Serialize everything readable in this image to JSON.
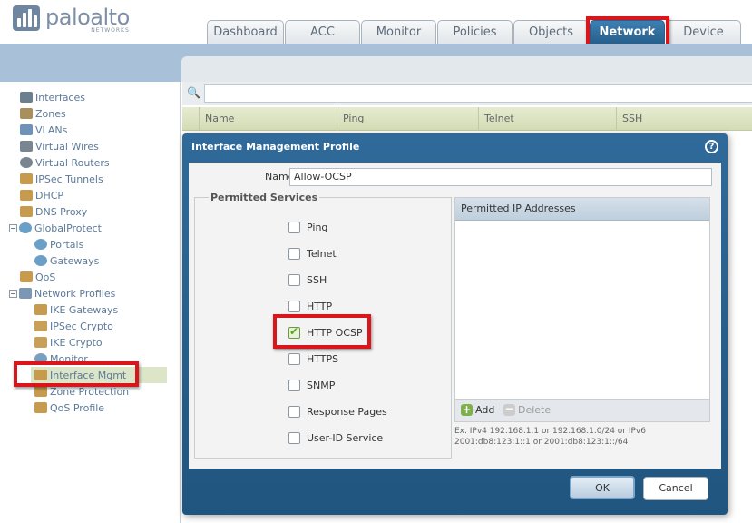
{
  "brand": {
    "name": "paloalto",
    "sub": "NETWORKS"
  },
  "tabs": [
    {
      "label": "Dashboard"
    },
    {
      "label": "ACC"
    },
    {
      "label": "Monitor"
    },
    {
      "label": "Policies"
    },
    {
      "label": "Objects"
    },
    {
      "label": "Network",
      "active": true
    },
    {
      "label": "Device"
    }
  ],
  "sidebar": {
    "items": [
      {
        "label": "Interfaces",
        "icon": "interfaces-icon",
        "color": "#6b7f8f"
      },
      {
        "label": "Zones",
        "icon": "zones-icon",
        "color": "#a98f5b"
      },
      {
        "label": "VLANs",
        "icon": "vlans-icon",
        "color": "#6f93b8"
      },
      {
        "label": "Virtual Wires",
        "icon": "virtual-wires-icon",
        "color": "#7a8592"
      },
      {
        "label": "Virtual Routers",
        "icon": "virtual-routers-icon",
        "color": "#7a8592"
      },
      {
        "label": "IPSec Tunnels",
        "icon": "ipsec-tunnels-icon",
        "color": "#c79b4d"
      },
      {
        "label": "DHCP",
        "icon": "dhcp-icon",
        "color": "#c79b4d"
      },
      {
        "label": "DNS Proxy",
        "icon": "dns-proxy-icon",
        "color": "#c79b4d"
      },
      {
        "label": "GlobalProtect",
        "icon": "globalprotect-icon",
        "color": "#6aa0c8"
      },
      {
        "label": "Portals",
        "icon": "portals-icon",
        "color": "#6aa0c8"
      },
      {
        "label": "Gateways",
        "icon": "gateways-icon",
        "color": "#6aa0c8"
      },
      {
        "label": "QoS",
        "icon": "qos-icon",
        "color": "#c79b4d"
      },
      {
        "label": "Network Profiles",
        "icon": "network-profiles-icon",
        "color": "#7b97b5"
      },
      {
        "label": "IKE Gateways",
        "icon": "ike-gateways-icon",
        "color": "#c79b4d"
      },
      {
        "label": "IPSec Crypto",
        "icon": "ipsec-crypto-icon",
        "color": "#c9a05a"
      },
      {
        "label": "IKE Crypto",
        "icon": "ike-crypto-icon",
        "color": "#c9a05a"
      },
      {
        "label": "Monitor",
        "icon": "monitor-icon",
        "color": "#7aa0c0"
      },
      {
        "label": "Interface Mgmt",
        "icon": "interface-mgmt-icon",
        "color": "#c79b4d"
      },
      {
        "label": "Zone Protection",
        "icon": "zone-protection-icon",
        "color": "#c79b4d"
      },
      {
        "label": "QoS Profile",
        "icon": "qos-profile-icon",
        "color": "#c79b4d"
      }
    ]
  },
  "grid": {
    "columns": [
      "Name",
      "Ping",
      "Telnet",
      "SSH"
    ]
  },
  "dialog": {
    "title": "Interface Management Profile",
    "name_label": "Name",
    "name_value": "Allow-OCSP",
    "services_legend": "Permitted Services",
    "services": [
      {
        "label": "Ping",
        "checked": false
      },
      {
        "label": "Telnet",
        "checked": false
      },
      {
        "label": "SSH",
        "checked": false
      },
      {
        "label": "HTTP",
        "checked": false
      },
      {
        "label": "HTTP OCSP",
        "checked": true
      },
      {
        "label": "HTTPS",
        "checked": false
      },
      {
        "label": "SNMP",
        "checked": false
      },
      {
        "label": "Response Pages",
        "checked": false
      },
      {
        "label": "User-ID Service",
        "checked": false
      }
    ],
    "ip_header": "Permitted IP Addresses",
    "add_label": "Add",
    "delete_label": "Delete",
    "ip_hint": "Ex. IPv4 192.168.1.1 or 192.168.1.0/24 or IPv6 2001:db8:123:1::1 or 2001:db8:123:1::/64",
    "ok_label": "OK",
    "cancel_label": "Cancel"
  },
  "colors": {
    "highlight": "#d9161c",
    "active_tab": "#2f6a9a",
    "check": "#58a423"
  }
}
